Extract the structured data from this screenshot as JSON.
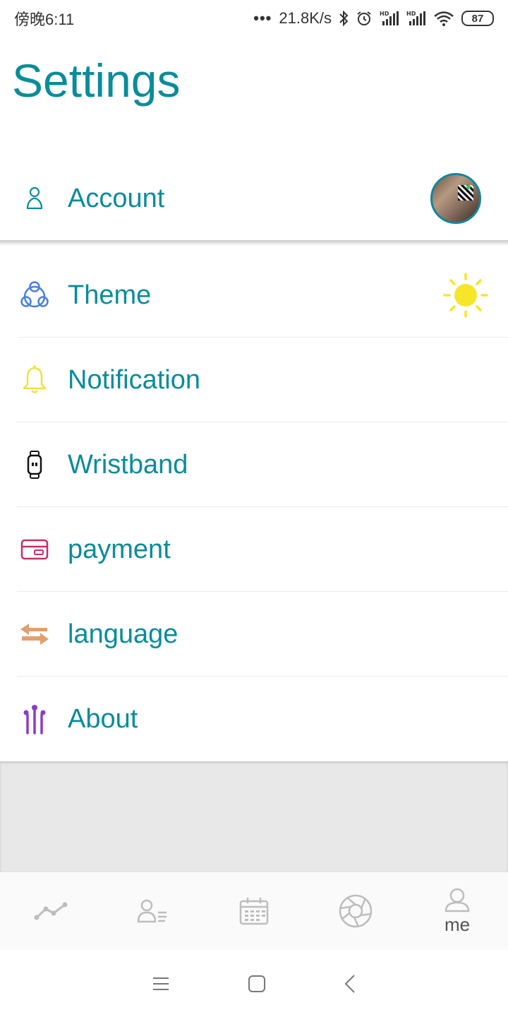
{
  "status_bar": {
    "time": "傍晚6:11",
    "dots": "•••",
    "network_speed": "21.8K/s",
    "battery": "87"
  },
  "page": {
    "title": "Settings"
  },
  "account": {
    "label": "Account"
  },
  "menu": {
    "items": [
      {
        "label": "Theme",
        "icon": "theme-icon",
        "color": "#4a7fe0"
      },
      {
        "label": "Notification",
        "icon": "bell-icon",
        "color": "#f0e040"
      },
      {
        "label": "Wristband",
        "icon": "wristband-icon",
        "color": "#111111"
      },
      {
        "label": "payment",
        "icon": "card-icon",
        "color": "#c0306a"
      },
      {
        "label": "language",
        "icon": "swap-arrows-icon",
        "color": "#e0a070"
      },
      {
        "label": "About",
        "icon": "tuning-fork-icon",
        "color": "#8a3cc8"
      }
    ]
  },
  "tabbar": {
    "tabs": [
      {
        "icon": "trend-line-icon"
      },
      {
        "icon": "contacts-icon"
      },
      {
        "icon": "calendar-icon"
      },
      {
        "icon": "aperture-icon"
      },
      {
        "icon": "person-icon",
        "label": "me"
      }
    ]
  },
  "colors": {
    "accent": "#0a8c9a",
    "sun": "#f5e62a"
  }
}
